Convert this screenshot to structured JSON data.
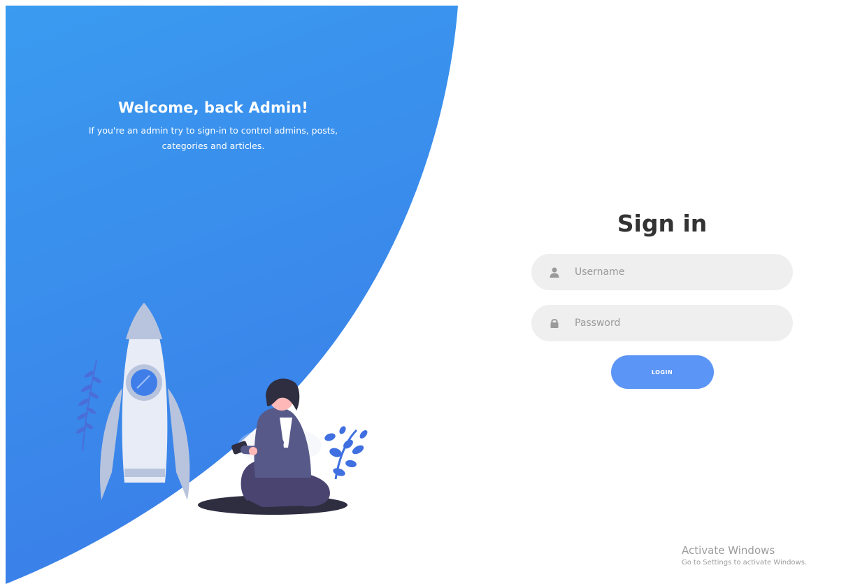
{
  "welcome": {
    "title": "Welcome, back Admin!",
    "text_line1": "If you're an admin try to sign-in to control admins, posts,",
    "text_line2": "categories and articles."
  },
  "signin": {
    "title": "Sign in",
    "username": {
      "placeholder": "Username",
      "value": "",
      "icon": "user-icon"
    },
    "password": {
      "placeholder": "Password",
      "value": "",
      "icon": "lock-icon"
    },
    "login_label": "LOGIN"
  },
  "watermark": {
    "title": "Activate Windows",
    "subtitle": "Go to Settings to activate Windows."
  },
  "colors": {
    "panel_top": "#3a9bf0",
    "panel_bottom": "#3a7fe8",
    "accent": "#5b95f5",
    "input_bg": "#efefef"
  }
}
